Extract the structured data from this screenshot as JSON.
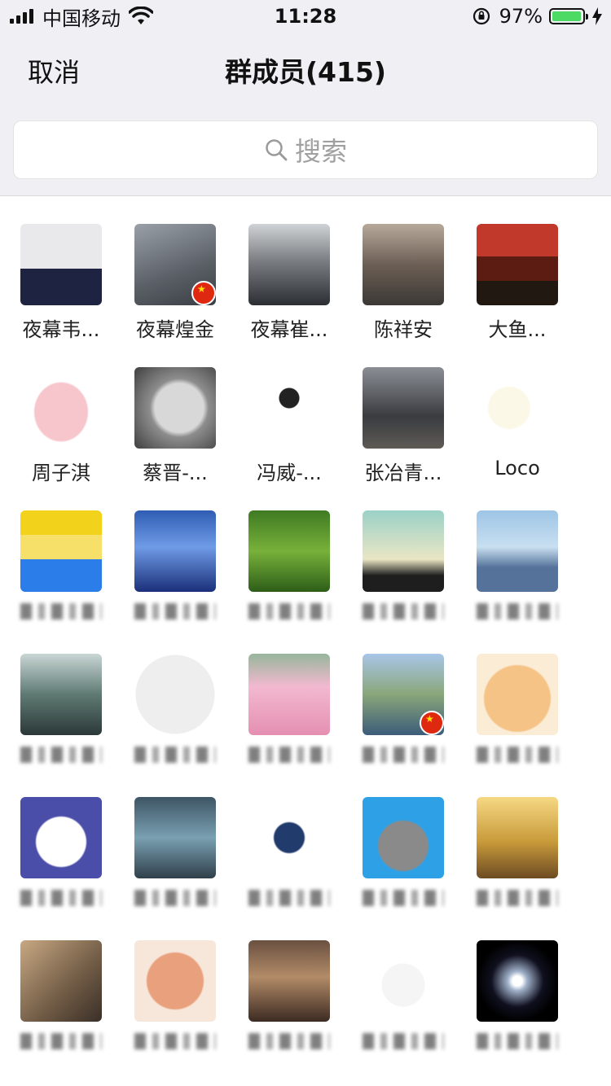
{
  "status_bar": {
    "carrier": "中国移动",
    "time": "11:28",
    "battery_percent": "97%",
    "battery_level": 0.97
  },
  "nav": {
    "cancel_label": "取消",
    "title": "群成员(415)"
  },
  "search": {
    "placeholder": "搜索"
  },
  "members": [
    {
      "name": "夜幕韦...",
      "avatar_icon": "man-in-suit-photo"
    },
    {
      "name": "夜幕煌金",
      "avatar_icon": "cat-photo",
      "flag": true
    },
    {
      "name": "夜幕崔...",
      "avatar_icon": "anime-boy-headphones"
    },
    {
      "name": "陈祥安",
      "avatar_icon": "dog-photo"
    },
    {
      "name": "大鱼...",
      "avatar_icon": "man-sitting-red-room"
    },
    {
      "name": "周子淇",
      "avatar_icon": "pink-pig-cartoon"
    },
    {
      "name": "蔡晋-...",
      "avatar_icon": "child-portrait-bw"
    },
    {
      "name": "冯威-...",
      "avatar_icon": "cartoon-boy-sketch"
    },
    {
      "name": "张冶青...",
      "avatar_icon": "man-crouching-photo"
    },
    {
      "name": "Loco",
      "avatar_icon": "cartoon-bun-sticker"
    },
    {
      "name": "",
      "avatar_icon": "crayon-shinchan"
    },
    {
      "name": "",
      "avatar_icon": "ocean-ice-landscape"
    },
    {
      "name": "",
      "avatar_icon": "tree-on-grass"
    },
    {
      "name": "",
      "avatar_icon": "sculpture-sunset"
    },
    {
      "name": "",
      "avatar_icon": "statue-of-liberty"
    },
    {
      "name": "",
      "avatar_icon": "woman-tattoo-arm"
    },
    {
      "name": "",
      "avatar_icon": "anime-samurai-circle"
    },
    {
      "name": "",
      "avatar_icon": "baby-pink-hat"
    },
    {
      "name": "",
      "avatar_icon": "river-landscape",
      "flag": true
    },
    {
      "name": "",
      "avatar_icon": "laughing-monk-cartoon"
    },
    {
      "name": "",
      "avatar_icon": "cartoon-boy-blue"
    },
    {
      "name": "",
      "avatar_icon": "anime-figure-pink-hair"
    },
    {
      "name": "",
      "avatar_icon": "cartoon-boy-cap"
    },
    {
      "name": "",
      "avatar_icon": "totoro-cartoon"
    },
    {
      "name": "",
      "avatar_icon": "person-sunset-silhouette"
    },
    {
      "name": "",
      "avatar_icon": "cat-with-glasses"
    },
    {
      "name": "",
      "avatar_icon": "pig-figurine"
    },
    {
      "name": "",
      "avatar_icon": "child-vintage-photo"
    },
    {
      "name": "",
      "avatar_icon": "white-cat-cartoon"
    },
    {
      "name": "",
      "avatar_icon": "black-hole-space"
    }
  ],
  "colors": {
    "header_bg": "#efeff4",
    "battery_green": "#4cd964"
  }
}
